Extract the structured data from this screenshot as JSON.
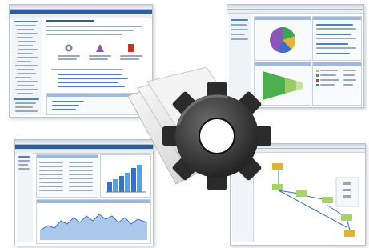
{
  "scene": {
    "description_free": true,
    "windows": [
      {
        "id": "admin-console",
        "tab_label": "Home",
        "icons": [
          "gear-icon",
          "wizard-icon",
          "server-icon"
        ]
      },
      {
        "id": "dashboard-pie",
        "chart_kind": "pie and funnel"
      },
      {
        "id": "report-window",
        "chart_kind": "bar and area"
      },
      {
        "id": "workflow-editor",
        "diagram_kind": "process flow"
      }
    ],
    "center_icon": "gear-icon",
    "colors": {
      "window_border": "#b9c4cf",
      "accent_blue": "#2f5d99",
      "gear_dark": "#2b2b2b",
      "flow_green": "#a6d26a",
      "pie_purple": "#8a56b8"
    }
  }
}
